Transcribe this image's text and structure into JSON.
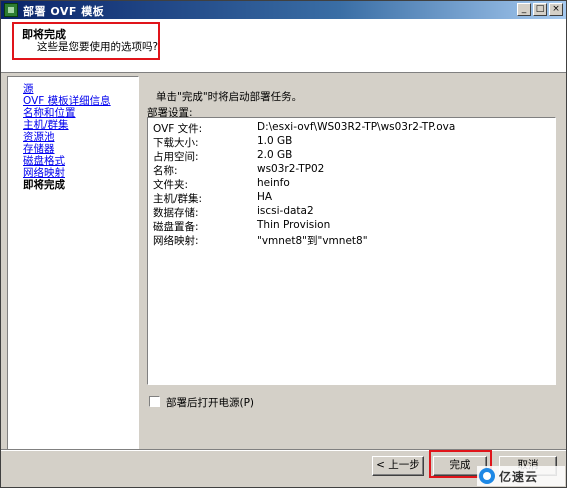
{
  "window": {
    "title": "部署 OVF 模板",
    "controls": {
      "minimize": "_",
      "maximize": "□",
      "close": "×"
    }
  },
  "header": {
    "title": "即将完成",
    "subtitle": "这些是您要使用的选项吗?"
  },
  "nav": {
    "items": [
      {
        "label": "源",
        "link": true
      },
      {
        "label": "OVF 模板详细信息",
        "link": true
      },
      {
        "label": "名称和位置",
        "link": true
      },
      {
        "label": "主机/群集",
        "link": true
      },
      {
        "label": "资源池",
        "link": true
      },
      {
        "label": "存储器",
        "link": true
      },
      {
        "label": "磁盘格式",
        "link": true
      },
      {
        "label": "网络映射",
        "link": true
      },
      {
        "label": "即将完成",
        "link": false
      }
    ]
  },
  "main": {
    "instruction": "单击\"完成\"时将启动部署任务。",
    "settings_label": "部署设置:",
    "settings": [
      {
        "key": "OVF 文件:",
        "value": "D:\\esxi-ovf\\WS03R2-TP\\ws03r2-TP.ova"
      },
      {
        "key": "下载大小:",
        "value": "1.0 GB"
      },
      {
        "key": "占用空间:",
        "value": "2.0 GB"
      },
      {
        "key": "名称:",
        "value": "ws03r2-TP02"
      },
      {
        "key": "文件夹:",
        "value": "heinfo"
      },
      {
        "key": "主机/群集:",
        "value": "HA"
      },
      {
        "key": "数据存储:",
        "value": "iscsi-data2"
      },
      {
        "key": "磁盘置备:",
        "value": "Thin Provision"
      },
      {
        "key": "网络映射:",
        "value": "\"vmnet8\"到\"vmnet8\""
      }
    ],
    "power_on_checkbox": {
      "label": "部署后打开电源(P)",
      "checked": false
    }
  },
  "buttons": {
    "back": "< 上一步",
    "finish": "完成",
    "cancel": "取消"
  },
  "watermark": {
    "text": "亿速云"
  },
  "colors": {
    "highlight": "#e0141a",
    "link": "#0000ee",
    "titlebar": "#0a246a"
  }
}
